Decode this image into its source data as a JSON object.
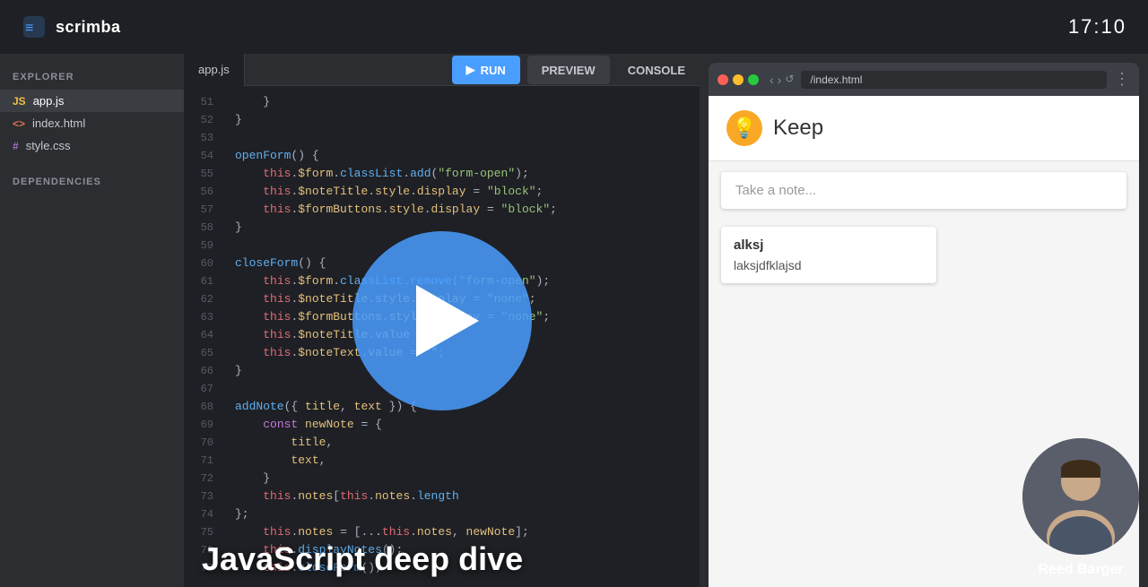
{
  "topbar": {
    "logo_text": "scrimba",
    "time": "17:10"
  },
  "editor_tabs": {
    "active_tab": "app.js"
  },
  "toolbar": {
    "run_label": "RUN",
    "preview_label": "PREVIEW",
    "console_label": "CONSOLE"
  },
  "sidebar": {
    "explorer_label": "EXPLORER",
    "files": [
      {
        "name": "app.js",
        "type": "js",
        "icon": "JS"
      },
      {
        "name": "index.html",
        "type": "html",
        "icon": "<>"
      },
      {
        "name": "style.css",
        "type": "css",
        "icon": "#"
      }
    ],
    "deps_label": "DEPENDENCIES"
  },
  "code": {
    "lines": [
      {
        "num": "51",
        "text": "    }"
      },
      {
        "num": "52",
        "text": "}"
      },
      {
        "num": "53",
        "text": ""
      },
      {
        "num": "54",
        "text": "openForm() {"
      },
      {
        "num": "55",
        "text": "    this.$form.classList.add(\"form-open\");"
      },
      {
        "num": "56",
        "text": "    this.$noteTitle.style.display = \"block\";"
      },
      {
        "num": "57",
        "text": "    this.$formButtons.style.display = \"block\";"
      },
      {
        "num": "58",
        "text": "}"
      },
      {
        "num": "59",
        "text": ""
      },
      {
        "num": "60",
        "text": "closeForm() {"
      },
      {
        "num": "61",
        "text": "    this.$form.classList.remove(\"form-open\");"
      },
      {
        "num": "62",
        "text": "    this.$noteTitle.style.display = \"none\";"
      },
      {
        "num": "63",
        "text": "    this.$formButtons.style.display = \"none\";"
      },
      {
        "num": "64",
        "text": "    this.$noteTitle.value = \"\";"
      },
      {
        "num": "65",
        "text": "    this.$noteText.value = \"\";"
      },
      {
        "num": "66",
        "text": "}"
      },
      {
        "num": "67",
        "text": ""
      },
      {
        "num": "68",
        "text": "addNote({ title, text }) {"
      },
      {
        "num": "69",
        "text": "    const newNote = {"
      },
      {
        "num": "70",
        "text": "        title,"
      },
      {
        "num": "71",
        "text": "        text,"
      },
      {
        "num": "72",
        "text": "    }"
      },
      {
        "num": "73",
        "text": "    this.notes[this.notes.length"
      },
      {
        "num": "74",
        "text": "};"
      },
      {
        "num": "75",
        "text": "    this.notes = [...this.notes, newNote];"
      },
      {
        "num": "76",
        "text": "    this.displayNotes();"
      },
      {
        "num": "77",
        "text": "    this.closeForm();"
      }
    ]
  },
  "course": {
    "title": "JavaScript deep dive"
  },
  "preview": {
    "url": "/index.html",
    "keep_title": "Keep",
    "take_note_placeholder": "Take a note...",
    "note": {
      "title": "alksj",
      "text": "laksjdfklajsd"
    }
  },
  "instructor": {
    "name": "Reed Barger"
  }
}
